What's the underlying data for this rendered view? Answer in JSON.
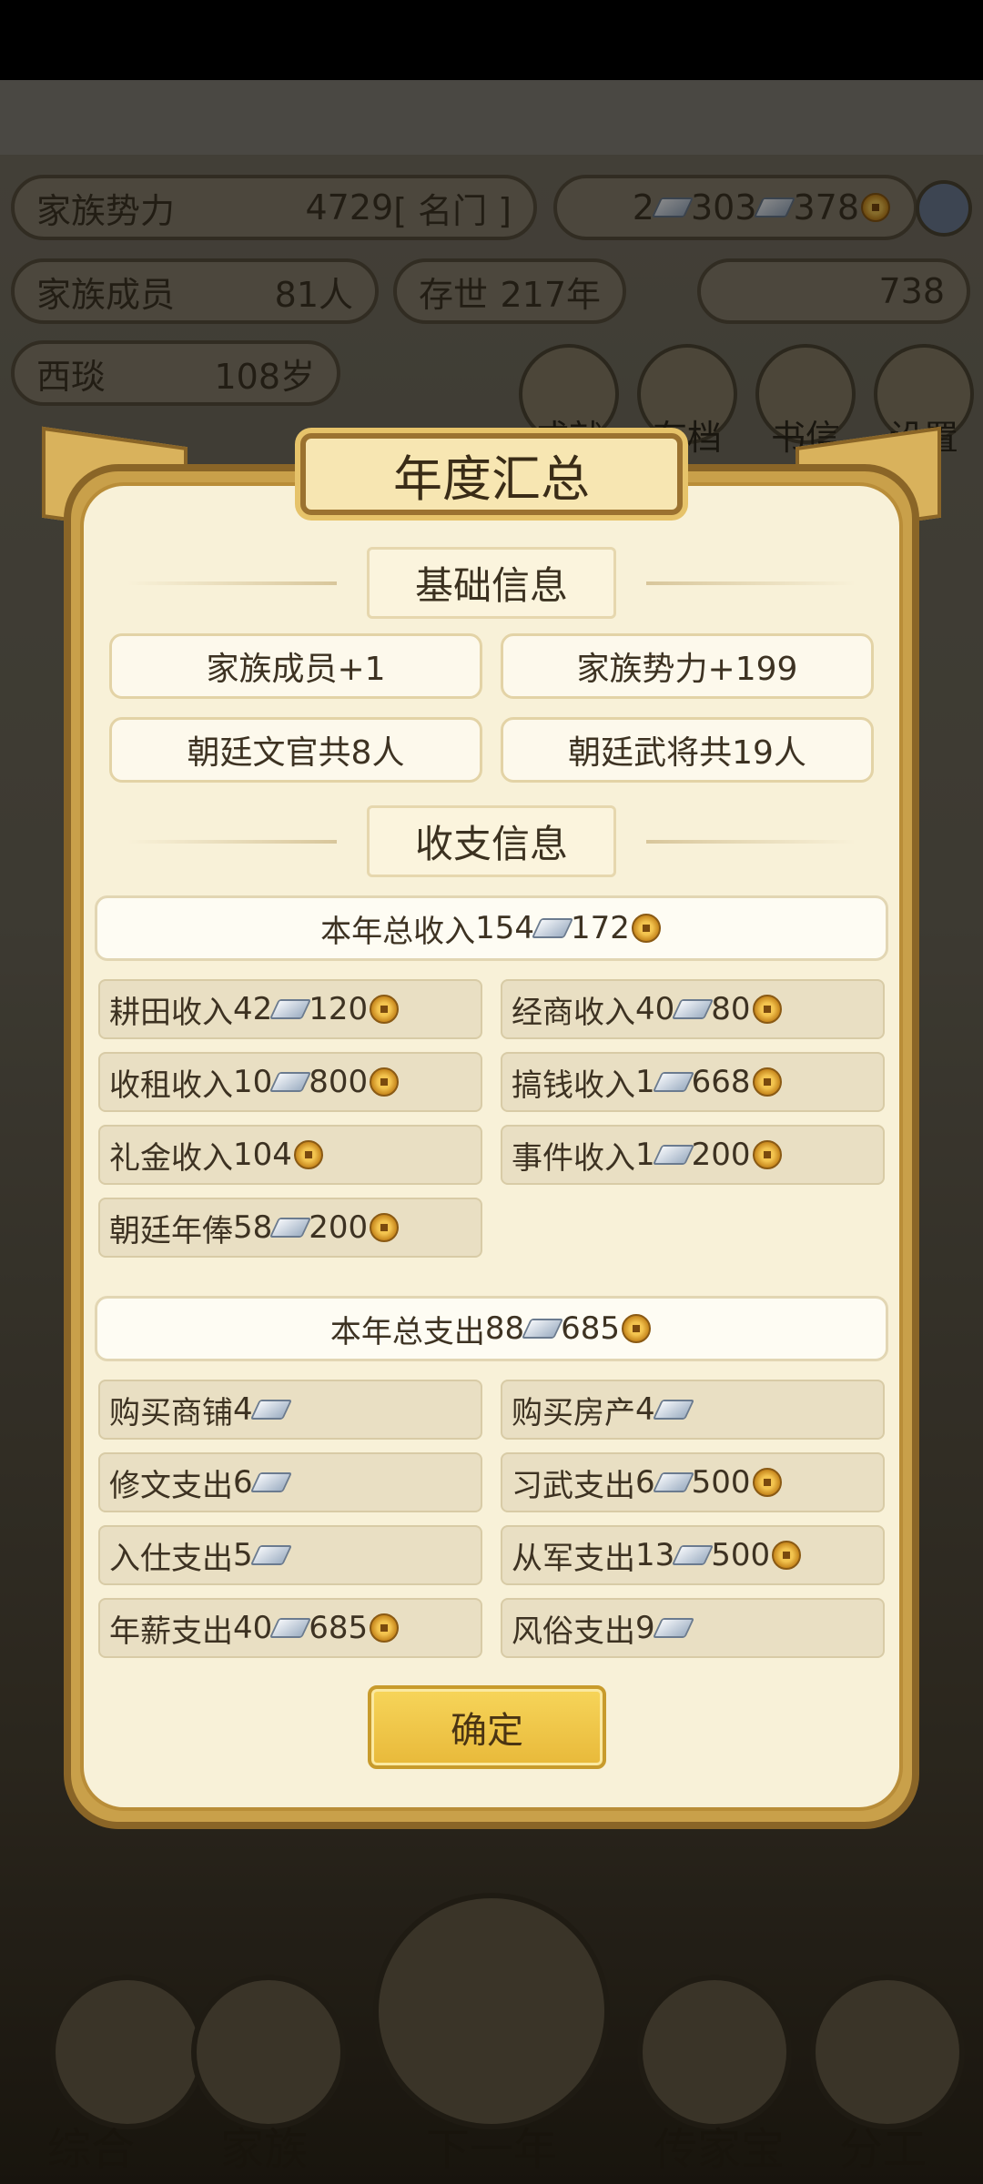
{
  "background": {
    "hud": {
      "power_label": "家族势力",
      "power_value": "4729",
      "power_rank": "[ 名门 ]",
      "currency_row": {
        "gold": "2",
        "silver": "303",
        "coin": "378"
      },
      "members_label": "家族成员",
      "members_value": "81人",
      "exist_label": "存世",
      "exist_value": "217年",
      "ingot_value": "738",
      "elder_name": "西琰",
      "elder_age": "108岁"
    },
    "icons": [
      "成就",
      "存档",
      "书信",
      "设置"
    ],
    "nav": [
      "综合",
      "家族",
      "下一年",
      "传家宝",
      "分工"
    ]
  },
  "modal": {
    "title": "年度汇总",
    "basic_section": {
      "title": "基础信息",
      "cards": [
        "家族成员+1",
        "家族势力+199",
        "朝廷文官共8人",
        "朝廷武将共19人"
      ]
    },
    "finance_section": {
      "title": "收支信息",
      "income_total": {
        "label": "本年总收入 ",
        "silver": "154",
        "coin": "172"
      },
      "income_items": [
        {
          "label": "耕田收入",
          "silver": "42",
          "coin": "120"
        },
        {
          "label": "经商收入",
          "silver": "40",
          "coin": "80"
        },
        {
          "label": "收租收入",
          "silver": "10",
          "coin": "800"
        },
        {
          "label": "搞钱收入",
          "silver": "1",
          "coin": "668"
        },
        {
          "label": "礼金收入",
          "silver": "",
          "coin": "104"
        },
        {
          "label": "事件收入",
          "silver": "1",
          "coin": "200"
        },
        {
          "label": "朝廷年俸",
          "silver": "58",
          "coin": "200"
        }
      ],
      "expense_total": {
        "label": "本年总支出",
        "silver": "88",
        "coin": "685"
      },
      "expense_items": [
        {
          "label": "购买商铺",
          "silver": "4",
          "coin": ""
        },
        {
          "label": "购买房产",
          "silver": "4",
          "coin": ""
        },
        {
          "label": "修文支出",
          "silver": "6",
          "coin": ""
        },
        {
          "label": "习武支出",
          "silver": "6",
          "coin": "500"
        },
        {
          "label": "入仕支出",
          "silver": "5",
          "coin": ""
        },
        {
          "label": "从军支出",
          "silver": "13",
          "coin": "500"
        },
        {
          "label": "年薪支出",
          "silver": "40",
          "coin": "685"
        },
        {
          "label": "风俗支出",
          "silver": "9",
          "coin": ""
        }
      ]
    },
    "confirm_label": "确定"
  }
}
